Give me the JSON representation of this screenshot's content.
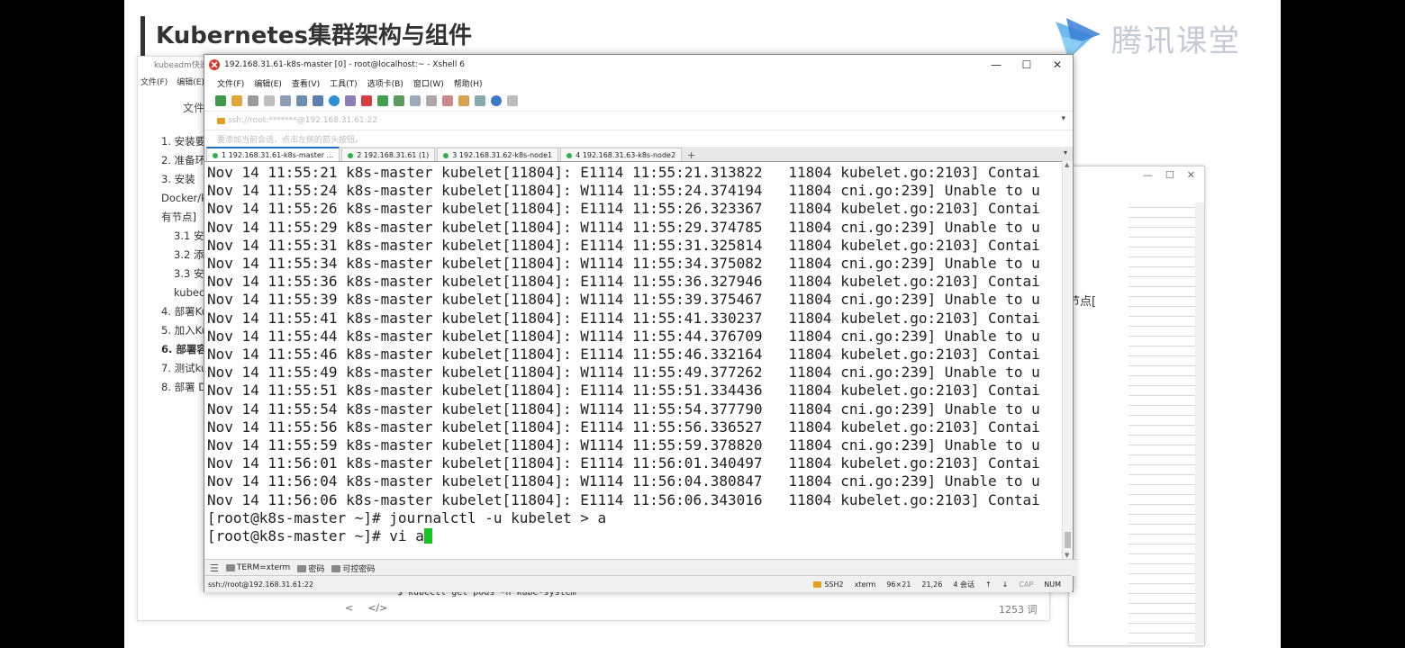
{
  "slide": {
    "title": "Kubernetes集群架构与组件",
    "logo_text": "腾讯课堂"
  },
  "doc": {
    "window_title": "kubeadm快速",
    "menu": [
      "文件(F)",
      "编辑(E)"
    ],
    "file_label": "文件",
    "toc": [
      {
        "text": "1. 安装要",
        "sub": false,
        "bold": false
      },
      {
        "text": "2. 准备环",
        "sub": false,
        "bold": false
      },
      {
        "text": "3. 安装",
        "sub": false,
        "bold": false
      },
      {
        "text": "Docker/k",
        "sub": false,
        "bold": false
      },
      {
        "text": "有节点]",
        "sub": false,
        "bold": false
      },
      {
        "text": "3.1 安装",
        "sub": true,
        "bold": false
      },
      {
        "text": "3.2 添加",
        "sub": true,
        "bold": false
      },
      {
        "text": "3.3 安装",
        "sub": true,
        "bold": false
      },
      {
        "text": "kubect",
        "sub": true,
        "bold": false
      },
      {
        "text": "4. 部署Ku",
        "sub": false,
        "bold": false
      },
      {
        "text": "5. 加入Ku",
        "sub": false,
        "bold": false
      },
      {
        "text": "6. 部署容",
        "sub": false,
        "bold": true
      },
      {
        "text": "7. 测试ku",
        "sub": false,
        "bold": false
      },
      {
        "text": "8. 部署 D",
        "sub": false,
        "bold": false
      }
    ],
    "code_line": "$ kubectl get pods -n kube-system",
    "bottom_controls": [
      "<",
      "</>"
    ],
    "word_count": "1253 词",
    "right_fragment": "节点["
  },
  "xshell": {
    "title": "192.168.31.61-k8s-master [0] - root@localhost:~ - Xshell 6",
    "controls": {
      "minimize": "—",
      "maximize": "☐",
      "close": "✕"
    },
    "menu": [
      "文件(F)",
      "编辑(E)",
      "查看(V)",
      "工具(T)",
      "选项卡(B)",
      "窗口(W)",
      "帮助(H)"
    ],
    "address": "ssh://root:*******@192.168.31.61:22",
    "info": "要添加当前会话，点击左侧的箭头按钮。",
    "tabs": [
      {
        "label": "1 192.168.31.61-k8s-master ...",
        "active": true
      },
      {
        "label": "2 192.168.31.61 (1)",
        "active": false
      },
      {
        "label": "3 192.168.31.62-k8s-node1",
        "active": false
      },
      {
        "label": "4 192.168.31.63-k8s-node2",
        "active": false
      }
    ],
    "tab_plus": "+",
    "tab_menu": "▾",
    "terminal_lines": [
      "Nov 14 11:55:21 k8s-master kubelet[11804]: E1114 11:55:21.313822   11804 kubelet.go:2103] Contai",
      "Nov 14 11:55:24 k8s-master kubelet[11804]: W1114 11:55:24.374194   11804 cni.go:239] Unable to u",
      "Nov 14 11:55:26 k8s-master kubelet[11804]: E1114 11:55:26.323367   11804 kubelet.go:2103] Contai",
      "Nov 14 11:55:29 k8s-master kubelet[11804]: W1114 11:55:29.374785   11804 cni.go:239] Unable to u",
      "Nov 14 11:55:31 k8s-master kubelet[11804]: E1114 11:55:31.325814   11804 kubelet.go:2103] Contai",
      "Nov 14 11:55:34 k8s-master kubelet[11804]: W1114 11:55:34.375082   11804 cni.go:239] Unable to u",
      "Nov 14 11:55:36 k8s-master kubelet[11804]: E1114 11:55:36.327946   11804 kubelet.go:2103] Contai",
      "Nov 14 11:55:39 k8s-master kubelet[11804]: W1114 11:55:39.375467   11804 cni.go:239] Unable to u",
      "Nov 14 11:55:41 k8s-master kubelet[11804]: E1114 11:55:41.330237   11804 kubelet.go:2103] Contai",
      "Nov 14 11:55:44 k8s-master kubelet[11804]: W1114 11:55:44.376709   11804 cni.go:239] Unable to u",
      "Nov 14 11:55:46 k8s-master kubelet[11804]: E1114 11:55:46.332164   11804 kubelet.go:2103] Contai",
      "Nov 14 11:55:49 k8s-master kubelet[11804]: W1114 11:55:49.377262   11804 cni.go:239] Unable to u",
      "Nov 14 11:55:51 k8s-master kubelet[11804]: E1114 11:55:51.334436   11804 kubelet.go:2103] Contai",
      "Nov 14 11:55:54 k8s-master kubelet[11804]: W1114 11:55:54.377790   11804 cni.go:239] Unable to u",
      "Nov 14 11:55:56 k8s-master kubelet[11804]: E1114 11:55:56.336527   11804 kubelet.go:2103] Contai",
      "Nov 14 11:55:59 k8s-master kubelet[11804]: W1114 11:55:59.378820   11804 cni.go:239] Unable to u",
      "Nov 14 11:56:01 k8s-master kubelet[11804]: E1114 11:56:01.340497   11804 kubelet.go:2103] Contai",
      "Nov 14 11:56:04 k8s-master kubelet[11804]: W1114 11:56:04.380847   11804 cni.go:239] Unable to u",
      "Nov 14 11:56:06 k8s-master kubelet[11804]: E1114 11:56:06.343016   11804 kubelet.go:2103] Contai",
      "[root@k8s-master ~]# journalctl -u kubelet > a"
    ],
    "prompt_line": "[root@k8s-master ~]# vi a",
    "compose_bar": [
      "TERM=xterm",
      "密码",
      "可控密码"
    ],
    "status": {
      "path": "ssh://root@192.168.31.61:22",
      "protocol": "SSH2",
      "term": "xterm",
      "size": "96×21",
      "cursor_pos": "21,26",
      "sessions": "4 会话",
      "cap": "CAP",
      "num": "NUM"
    },
    "cursor_color": "#16c424"
  },
  "icons": [
    "logo-play-icon",
    "xshell-app-icon",
    "lock-icon"
  ]
}
